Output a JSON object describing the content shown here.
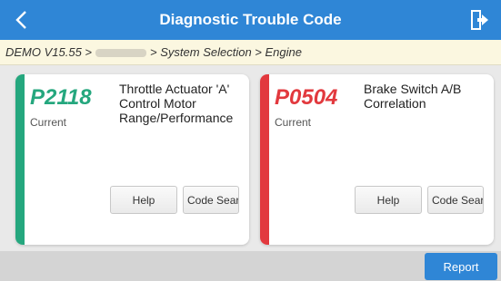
{
  "header": {
    "title": "Diagnostic Trouble Code",
    "back_icon": "chevron-left-icon",
    "exit_icon": "exit-door-icon",
    "color": "#2f86d6"
  },
  "breadcrumb": {
    "prefix": "DEMO V15.55 >",
    "suffix": "> System Selection > Engine"
  },
  "codes": [
    {
      "code": "P2118",
      "state": "Current",
      "description": "Throttle Actuator 'A' Control Motor Range/Performance",
      "color": "#25a77e",
      "help_label": "Help",
      "search_label": "Code Sear"
    },
    {
      "code": "P0504",
      "state": "Current",
      "description": "Brake Switch A/B Correlation",
      "color": "#e2393e",
      "help_label": "Help",
      "search_label": "Code Sear"
    }
  ],
  "footer": {
    "report_label": "Report"
  }
}
